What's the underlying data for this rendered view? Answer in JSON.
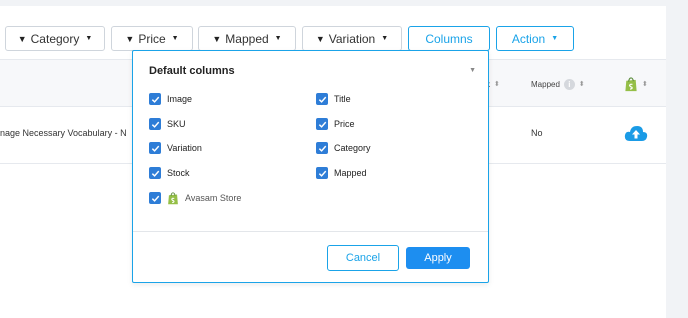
{
  "filters": {
    "category": "Category",
    "price": "Price",
    "mapped": "Mapped",
    "variation": "Variation",
    "columns": "Columns",
    "action": "Action"
  },
  "table": {
    "headers": {
      "stock_partial": "k",
      "mapped": "Mapped"
    },
    "row": {
      "title_partial": "nage Necessary Vocabulary - N",
      "mapped": "No"
    }
  },
  "columns_dropdown": {
    "title": "Default columns",
    "options": [
      {
        "label": "Image",
        "checked": true
      },
      {
        "label": "Title",
        "checked": true
      },
      {
        "label": "SKU",
        "checked": true
      },
      {
        "label": "Price",
        "checked": true
      },
      {
        "label": "Variation",
        "checked": true
      },
      {
        "label": "Category",
        "checked": true
      },
      {
        "label": "Stock",
        "checked": true
      },
      {
        "label": "Mapped",
        "checked": true
      },
      {
        "label": "Avasam Store",
        "checked": true
      }
    ],
    "cancel_label": "Cancel",
    "apply_label": "Apply"
  },
  "colors": {
    "accent": "#1aa3e8",
    "checkbox": "#2e7dd7",
    "apply": "#1d8ef0",
    "shopify": "#95bf47"
  },
  "icons": [
    "funnel-icon",
    "caret-down-icon",
    "sort-icon",
    "info-icon",
    "shopify-icon",
    "cloud-upload-icon",
    "checkmark-icon"
  ]
}
